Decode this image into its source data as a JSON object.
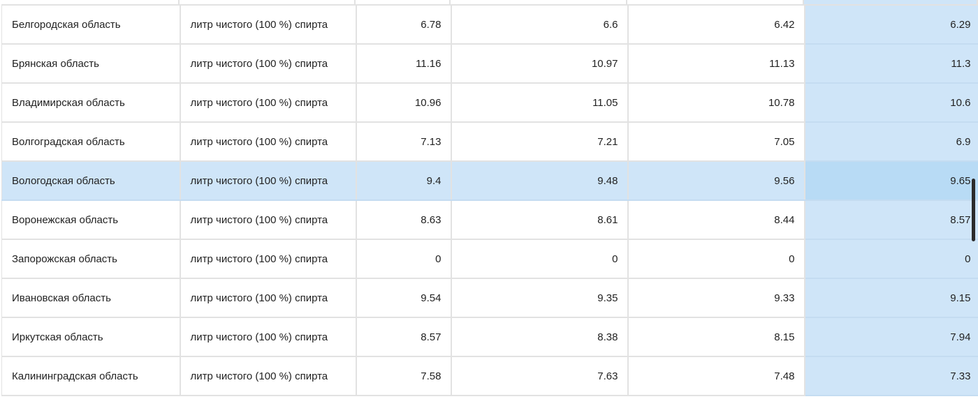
{
  "grid": {
    "selected_column": 5,
    "selected_row": 4,
    "rows": [
      {
        "region": "Белгородская область",
        "unit": "литр чистого (100 %) спирта",
        "values": [
          "6.78",
          "6.6",
          "6.42",
          "6.29"
        ]
      },
      {
        "region": "Брянская область",
        "unit": "литр чистого (100 %) спирта",
        "values": [
          "11.16",
          "10.97",
          "11.13",
          "11.3"
        ]
      },
      {
        "region": "Владимирская область",
        "unit": "литр чистого (100 %) спирта",
        "values": [
          "10.96",
          "11.05",
          "10.78",
          "10.6"
        ]
      },
      {
        "region": "Волгоградская область",
        "unit": "литр чистого (100 %) спирта",
        "values": [
          "7.13",
          "7.21",
          "7.05",
          "6.9"
        ]
      },
      {
        "region": "Вологодская область",
        "unit": "литр чистого (100 %) спирта",
        "values": [
          "9.4",
          "9.48",
          "9.56",
          "9.65"
        ]
      },
      {
        "region": "Воронежская область",
        "unit": "литр чистого (100 %) спирта",
        "values": [
          "8.63",
          "8.61",
          "8.44",
          "8.57"
        ]
      },
      {
        "region": "Запорожская область",
        "unit": "литр чистого (100 %) спирта",
        "values": [
          "0",
          "0",
          "0",
          "0"
        ]
      },
      {
        "region": "Ивановская область",
        "unit": "литр чистого (100 %) спирта",
        "values": [
          "9.54",
          "9.35",
          "9.33",
          "9.15"
        ]
      },
      {
        "region": "Иркутская область",
        "unit": "литр чистого (100 %) спирта",
        "values": [
          "8.57",
          "8.38",
          "8.15",
          "7.94"
        ]
      },
      {
        "region": "Калининградская область",
        "unit": "литр чистого (100 %) спирта",
        "values": [
          "7.58",
          "7.63",
          "7.48",
          "7.33"
        ]
      }
    ]
  },
  "colors": {
    "selection": "#cfe5f8",
    "selection_intersection": "#b8dbf5",
    "grid_line": "#e2e2e2",
    "scrollbar_thumb": "#2b2b2b"
  }
}
